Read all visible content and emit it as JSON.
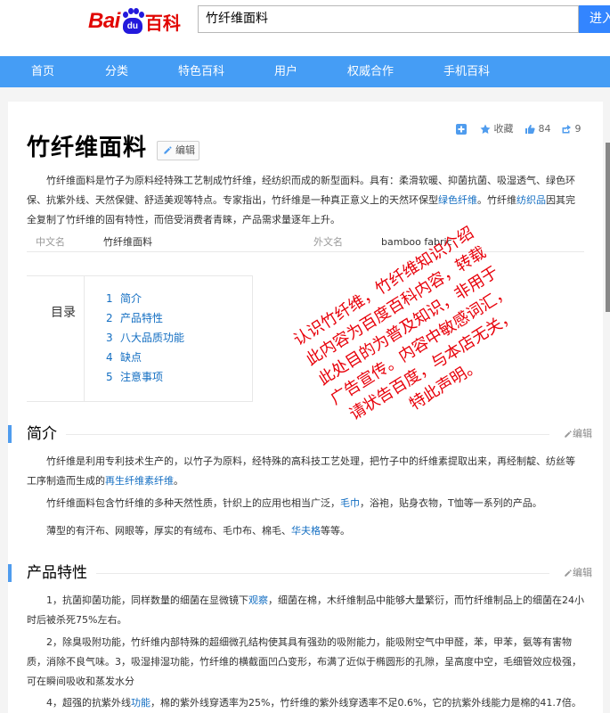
{
  "header": {
    "logo_bai": "Bai",
    "logo_du": "du",
    "logo_ke": "百科",
    "search_value": "竹纤维面料",
    "search_button": "进入"
  },
  "nav": [
    "首页",
    "分类",
    "特色百科",
    "用户",
    "权威合作",
    "手机百科"
  ],
  "tools": {
    "favorite_label": "收藏",
    "like_count": "84",
    "share_count": "9"
  },
  "article": {
    "title": "竹纤维面料",
    "edit_label": "编辑",
    "intro": {
      "t1": "竹纤维面料是竹子为原料经特殊工艺制成竹纤维，经纺织而成的新型面料。具有：柔滑软暖、抑菌抗菌、吸湿透气、绿色环保、抗紫外线、天然保健、舒适美观等特点。专家指出，竹纤维是一种真正意义上的天然环保型",
      "l1": "绿色纤维",
      "t2": "。竹纤维",
      "l2": "纺织品",
      "t3": "因其完全复制了竹纤维的固有特性，而倍受消费者青睐，产品需求量逐年上升。"
    },
    "basic_info": {
      "cn_name_label": "中文名",
      "cn_name_value": "竹纤维面料",
      "foreign_name_label": "外文名",
      "foreign_name_value": "bamboo fabric"
    },
    "toc": {
      "label": "目录",
      "items": [
        {
          "num": "1",
          "text": "简介"
        },
        {
          "num": "2",
          "text": "产品特性"
        },
        {
          "num": "3",
          "text": "八大品质功能"
        },
        {
          "num": "4",
          "text": "缺点"
        },
        {
          "num": "5",
          "text": "注意事项"
        }
      ]
    },
    "section1": {
      "title": "简介",
      "edit_label": "编辑",
      "p1_t1": "竹纤维是利用专利技术生产的，以竹子为原料，经特殊的高科技工艺处理，把竹子中的纤维素提取出来，再经制靛、纺丝等工序制造而生成的",
      "p1_l1": "再生纤维素纤维",
      "p1_t2": "。",
      "p2_t1": "竹纤维面料包含竹纤维的多种天然性质，针织上的应用也相当广泛，",
      "p2_l1": "毛巾",
      "p2_t2": "，浴袍，贴身衣物，T恤等一系列的产品。",
      "p3_t1": "薄型的有汗布、网眼等，厚实的有绒布、毛巾布、棉毛、",
      "p3_l1": "华夫格",
      "p3_t2": "等等。"
    },
    "section2": {
      "title": "产品特性",
      "edit_label": "编辑",
      "p1_t1": "1，抗菌抑菌功能，同样数量的细菌在显微镜下",
      "p1_l1": "观察",
      "p1_t2": "，细菌在棉，木纤维制品中能够大量繁衍，而竹纤维制品上的细菌在24小时后被杀死75%左右。",
      "p2": "2，除臭吸附功能，竹纤维内部特殊的超细微孔结构使其具有强劲的吸附能力，能吸附空气中甲醛，苯，甲苯，氨等有害物质，消除不良气味。3，吸湿排湿功能，竹纤维的横截面凹凸变形，布满了近似于椭圆形的孔隙，呈高度中空，毛细管效应极强，可在瞬间吸收和蒸发水分",
      "p3_t1": "4，超强的抗紫外线",
      "p3_l1": "功能",
      "p3_t2": "，棉的紫外线穿透率为25%，竹纤维的紫外线穿透率不足0.6%，它的抗紫外线能力是棉的41.7倍。"
    }
  },
  "watermark": {
    "lines": [
      "认识竹纤维，竹纤维知识介绍",
      "此内容为百度百科内容，转载",
      "此处目的为普及知识，非用于",
      "广告宣传。内容中敏感词汇，",
      "请状告百度，与本店无关，",
      "特此声明。"
    ]
  },
  "colors": {
    "nav_bg": "#459df5",
    "link": "#136ec2",
    "logo_red": "#e10602",
    "logo_blue": "#2319dc",
    "watermark": "#e8000a"
  }
}
